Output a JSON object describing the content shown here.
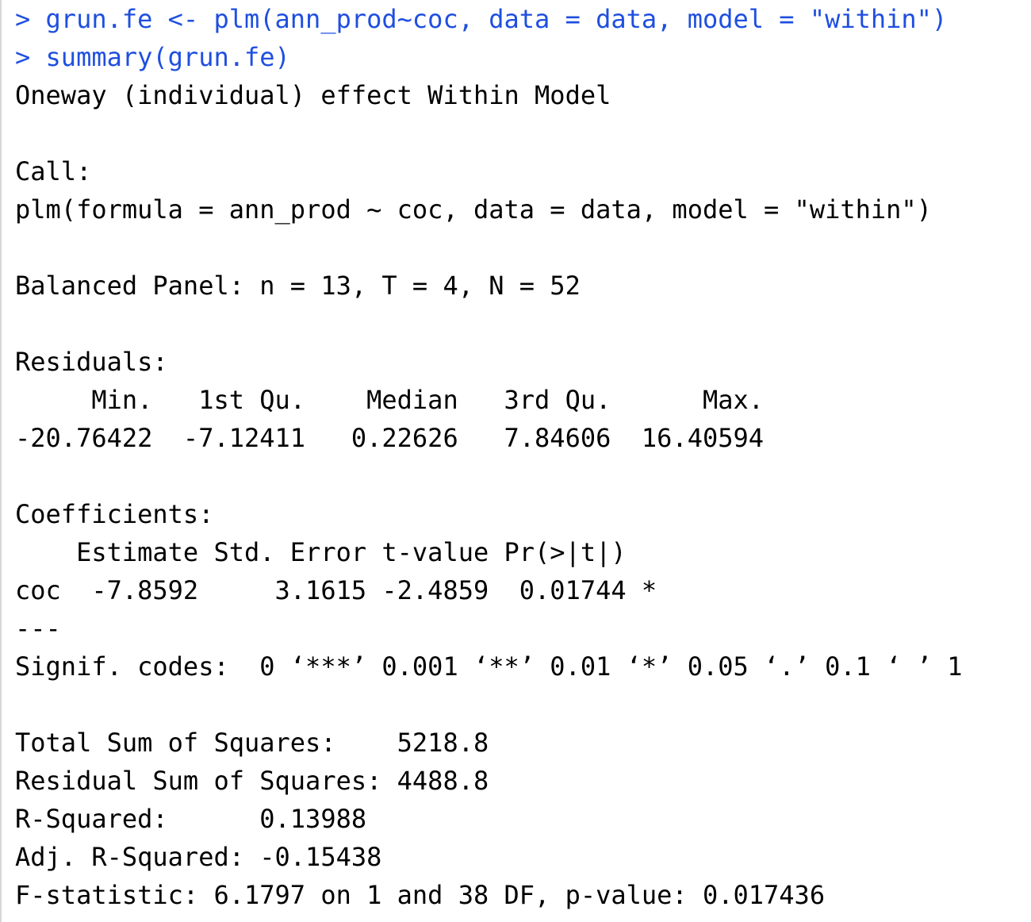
{
  "console": {
    "colors": {
      "command": "#1f4fe0",
      "output": "#000000",
      "background": "#ffffff"
    },
    "commands": [
      {
        "prompt": "> ",
        "text": "grun.fe <- plm(ann_prod~coc, data = data, model = \"within\")"
      },
      {
        "prompt": "> ",
        "text": "summary(grun.fe)"
      }
    ],
    "output": {
      "model_title": "Oneway (individual) effect Within Model",
      "call_header": "Call:",
      "call_text": "plm(formula = ann_prod ~ coc, data = data, model = \"within\")",
      "panel_info": "Balanced Panel: n = 13, T = 4, N = 52",
      "residuals_header": "Residuals:",
      "residuals_labels": "     Min.   1st Qu.    Median   3rd Qu.      Max. ",
      "residuals_values": "-20.76422  -7.12411   0.22626   7.84606  16.40594 ",
      "coefficients_header": "Coefficients:",
      "coefficients_columns": "    Estimate Std. Error t-value Pr(>|t|)  ",
      "coefficients_row": "coc  -7.8592     3.1615 -2.4859  0.01744 *",
      "separator": "---",
      "signif_codes": "Signif. codes:  0 ‘***’ 0.001 ‘**’ 0.01 ‘*’ 0.05 ‘.’ 0.1 ‘ ’ 1",
      "total_ss": "Total Sum of Squares:    5218.8",
      "residual_ss": "Residual Sum of Squares: 4488.8",
      "r_squared": "R-Squared:      0.13988",
      "adj_r_squared": "Adj. R-Squared: -0.15438",
      "f_statistic": "F-statistic: 6.1797 on 1 and 38 DF, p-value: 0.017436"
    }
  }
}
